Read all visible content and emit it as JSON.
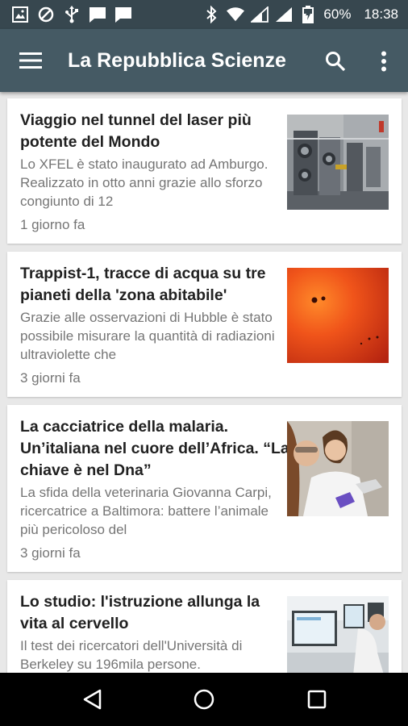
{
  "status_bar": {
    "battery": "60%",
    "time": "18:38"
  },
  "app_bar": {
    "title": "La Repubblica Scienze"
  },
  "articles": [
    {
      "title": "Viaggio nel tunnel del laser più potente del Mondo",
      "summary": "Lo XFEL è stato inaugurato ad Amburgo. Realizzato in otto anni grazie allo sforzo congiunto di 12",
      "time": "1 giorno fa"
    },
    {
      "title": "Trappist-1, tracce di acqua su tre pianeti della 'zona abitabile'",
      "summary": "Grazie alle osservazioni di Hubble è stato possibile misurare la quantità di radiazioni ultraviolette che",
      "time": "3 giorni fa"
    },
    {
      "title": "La cacciatrice della malaria. Un’italiana nel cuore dell’Africa. “La chiave è nel Dna”",
      "summary": "La sfida della veterinaria Giovanna Carpi, ricercatrice a Baltimora: battere l’animale più pericoloso del",
      "time": "3 giorni fa"
    },
    {
      "title": "Lo studio: l'istruzione allunga la vita al cervello",
      "summary": "Il test dei ricercatori dell'Università di Berkeley su 196mila persone.",
      "time": ""
    }
  ],
  "colors": {
    "status_bar": "#37474f",
    "app_bar": "#455a64",
    "background": "#e8e8e8"
  }
}
